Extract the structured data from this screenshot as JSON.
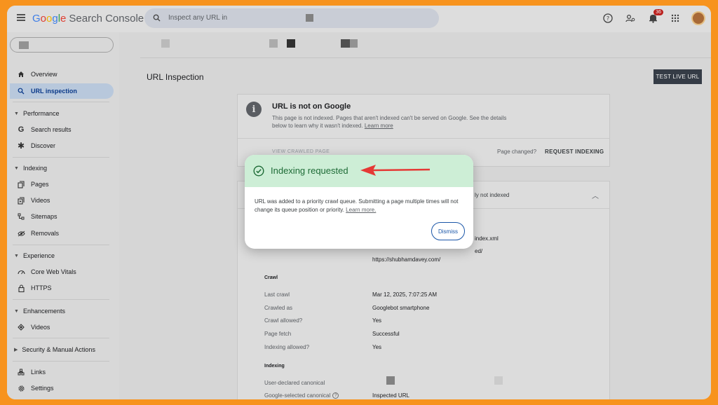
{
  "app": {
    "logo_word": "Google",
    "product": "Search Console"
  },
  "search": {
    "placeholder": "Inspect any URL in"
  },
  "notifications": {
    "count": "36"
  },
  "sidebar": {
    "items": [
      {
        "label": "Overview",
        "icon": "home-icon"
      },
      {
        "label": "URL inspection",
        "icon": "search-icon",
        "active": true
      }
    ],
    "sections": [
      {
        "title": "Performance",
        "items": [
          {
            "label": "Search results",
            "icon": "google-g-icon"
          },
          {
            "label": "Discover",
            "icon": "asterisk-icon"
          }
        ]
      },
      {
        "title": "Indexing",
        "items": [
          {
            "label": "Pages",
            "icon": "pages-icon"
          },
          {
            "label": "Videos",
            "icon": "video-page-icon"
          },
          {
            "label": "Sitemaps",
            "icon": "sitemap-icon"
          },
          {
            "label": "Removals",
            "icon": "removal-icon"
          }
        ]
      },
      {
        "title": "Experience",
        "items": [
          {
            "label": "Core Web Vitals",
            "icon": "gauge-icon"
          },
          {
            "label": "HTTPS",
            "icon": "lock-icon"
          }
        ]
      },
      {
        "title": "Enhancements",
        "items": [
          {
            "label": "Videos",
            "icon": "diamond-icon"
          }
        ]
      },
      {
        "title": "Security & Manual Actions",
        "items": []
      }
    ],
    "bottom": [
      {
        "label": "Links",
        "icon": "links-icon"
      },
      {
        "label": "Settings",
        "icon": "gear-icon"
      }
    ]
  },
  "main": {
    "title": "URL Inspection",
    "test_live_url": "TEST LIVE URL",
    "status_card": {
      "title": "URL is not on Google",
      "body": "This page is not indexed. Pages that aren't indexed can't be served on Google. See the details below to learn why it wasn't indexed.",
      "learn_more": "Learn more",
      "view_crawled": "VIEW CRAWLED PAGE",
      "page_changed": "Page changed?",
      "request_indexing": "REQUEST INDEXING"
    },
    "details_card": {
      "header_fragment": "ly not indexed",
      "fragment_sitemap": "index.xml",
      "fragment_referring": "ed/",
      "referring_url": "https://shubhamdavey.com/",
      "crawl_heading": "Crawl",
      "crawl_rows": [
        {
          "label": "Last crawl",
          "value": "Mar 12, 2025, 7:07:25 AM"
        },
        {
          "label": "Crawled as",
          "value": "Googlebot smartphone"
        },
        {
          "label": "Crawl allowed?",
          "value": "Yes"
        },
        {
          "label": "Page fetch",
          "value": "Successful"
        },
        {
          "label": "Indexing allowed?",
          "value": "Yes"
        }
      ],
      "indexing_heading": "Indexing",
      "user_canonical_label": "User-declared canonical",
      "google_canonical_label": "Google-selected canonical",
      "google_canonical_value": "Inspected URL"
    }
  },
  "modal": {
    "title": "Indexing requested",
    "body": "URL was added to a priority crawl queue. Submitting a page multiple times will not change its queue position or priority.",
    "learn_more": "Learn more.",
    "dismiss": "Dismiss"
  },
  "colors": {
    "frame": "#F7931E",
    "modal_header": "#cdeed6",
    "success_text": "#1e6b36",
    "arrow": "#e53935",
    "dismiss": "#1a56a8"
  }
}
